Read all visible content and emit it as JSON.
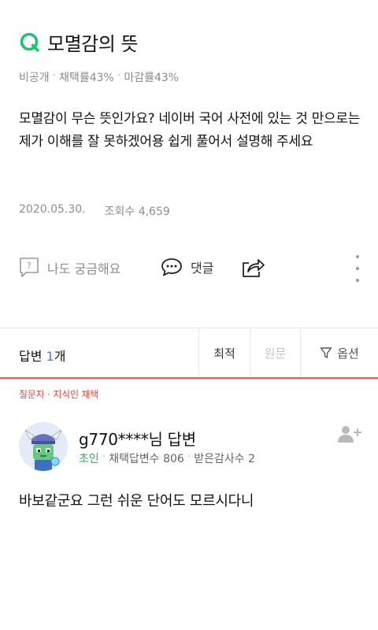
{
  "question": {
    "title": "모멸감의 뜻",
    "meta": {
      "visibility": "비공개",
      "adoption_rate": "채택률43%",
      "closing_rate": "마감률43%"
    },
    "body": "모멸감이 무슨 뜻인가요? 네이버 국어 사전에 있는 것 만으로는 제가 이해를 잘 못하겠어용 쉽게 풀어서 설명해 주세요",
    "date": "2020.05.30.",
    "views": "조회수 4,659"
  },
  "actions": {
    "curious_label": "나도 궁금해요",
    "comment_label": "댓글",
    "curious_icon_glyph": "?"
  },
  "answers_bar": {
    "label_prefix": "답변 ",
    "count": "1",
    "label_suffix": "개",
    "sort_latest": "최적",
    "sort_original": "원문",
    "option": "옵션"
  },
  "answer": {
    "chosen_label": "질문자 · 지식인 채택",
    "name": "g770****님 답변",
    "rank": "초인",
    "adopted_count": "채택답변수 806",
    "thanks_count": "받은감사수 2",
    "body": "바보같군요 그런 쉬운 단어도 모르시다니"
  },
  "colors": {
    "accent_green": "#1ec36b",
    "accent_red": "#f05a4a",
    "count_blue": "#3b7cf1"
  }
}
